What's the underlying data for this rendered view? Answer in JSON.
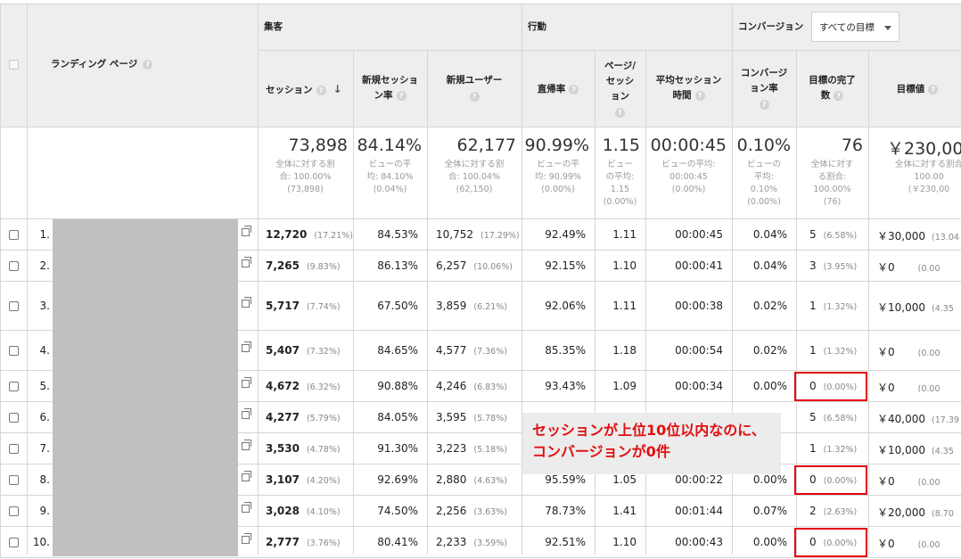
{
  "column_groups": {
    "acquisition": "集客",
    "behavior": "行動",
    "conversions": "コンバージョン"
  },
  "goal_selector": {
    "value": "すべての目標"
  },
  "columns": {
    "landing_page": "ランディング ページ",
    "sessions": "セッション",
    "new_session_rate": [
      "新規セッショ",
      "ン率"
    ],
    "new_users": "新規ユーザー",
    "bounce_rate": "直帰率",
    "pages_per_session": [
      "ページ/",
      "セッシ",
      "ョン"
    ],
    "avg_session_duration": [
      "平均セッション",
      "時間"
    ],
    "conversion_rate": [
      "コンバージ",
      "ョン率"
    ],
    "goal_completions": [
      "目標の完了",
      "数"
    ],
    "goal_value": "目標値"
  },
  "totals": {
    "sessions": {
      "value": "73,898",
      "lines": [
        "全体に対する割",
        "合: 100.00%",
        "(73,898)"
      ]
    },
    "new_session_rate": {
      "value": "84.14%",
      "lines": [
        "ビューの平",
        "均: 84.10%",
        "(0.04%)"
      ]
    },
    "new_users": {
      "value": "62,177",
      "lines": [
        "全体に対する割",
        "合: 100.04%",
        "(62,150)"
      ]
    },
    "bounce_rate": {
      "value": "90.99%",
      "lines": [
        "ビューの平",
        "均: 90.99%",
        "(0.00%)"
      ]
    },
    "pages_per_session": {
      "value": "1.15",
      "lines": [
        "ビュー",
        "の平均:",
        "1.15",
        "(0.00%)"
      ]
    },
    "avg_session_duration": {
      "value": "00:00:45",
      "lines": [
        "ビューの平均:",
        "00:00:45",
        "(0.00%)"
      ]
    },
    "conversion_rate": {
      "value": "0.10%",
      "lines": [
        "ビューの",
        "平均:",
        "0.10%",
        "(0.00%)"
      ]
    },
    "goal_completions": {
      "value": "76",
      "lines": [
        "全体に対す",
        "る割合:",
        "100.00%",
        "(76)"
      ]
    },
    "goal_value": {
      "value": "￥230,00",
      "lines": [
        "全体に対する割合",
        "100.00",
        "(￥230,00"
      ]
    }
  },
  "rows": [
    {
      "num": "1.",
      "sessions": "12,720",
      "sessions_pct": "(17.21%)",
      "new_session_rate": "84.53%",
      "new_users": "10,752",
      "new_users_pct": "(17.29%)",
      "bounce_rate": "92.49%",
      "pages_per_session": "1.11",
      "avg_session_duration": "00:00:45",
      "conversion_rate": "0.04%",
      "goal_completions": "5",
      "goal_completions_pct": "(6.58%)",
      "goal_value": "￥30,000",
      "goal_value_pct": "(13.04"
    },
    {
      "num": "2.",
      "sessions": "7,265",
      "sessions_pct": "(9.83%)",
      "new_session_rate": "86.13%",
      "new_users": "6,257",
      "new_users_pct": "(10.06%)",
      "bounce_rate": "92.15%",
      "pages_per_session": "1.10",
      "avg_session_duration": "00:00:41",
      "conversion_rate": "0.04%",
      "goal_completions": "3",
      "goal_completions_pct": "(3.95%)",
      "goal_value": "￥0",
      "goal_value_pct": "(0.00"
    },
    {
      "num": "3.",
      "sessions": "5,717",
      "sessions_pct": "(7.74%)",
      "new_session_rate": "67.50%",
      "new_users": "3,859",
      "new_users_pct": "(6.21%)",
      "bounce_rate": "92.06%",
      "pages_per_session": "1.11",
      "avg_session_duration": "00:00:38",
      "conversion_rate": "0.02%",
      "goal_completions": "1",
      "goal_completions_pct": "(1.32%)",
      "goal_value": "￥10,000",
      "goal_value_pct": "(4.35"
    },
    {
      "num": "4.",
      "sessions": "5,407",
      "sessions_pct": "(7.32%)",
      "new_session_rate": "84.65%",
      "new_users": "4,577",
      "new_users_pct": "(7.36%)",
      "bounce_rate": "85.35%",
      "pages_per_session": "1.18",
      "avg_session_duration": "00:00:54",
      "conversion_rate": "0.02%",
      "goal_completions": "1",
      "goal_completions_pct": "(1.32%)",
      "goal_value": "￥0",
      "goal_value_pct": "(0.00"
    },
    {
      "num": "5.",
      "sessions": "4,672",
      "sessions_pct": "(6.32%)",
      "new_session_rate": "90.88%",
      "new_users": "4,246",
      "new_users_pct": "(6.83%)",
      "bounce_rate": "93.43%",
      "pages_per_session": "1.09",
      "avg_session_duration": "00:00:34",
      "conversion_rate": "0.00%",
      "goal_completions": "0",
      "goal_completions_pct": "(0.00%)",
      "goal_value": "￥0",
      "goal_value_pct": "(0.00"
    },
    {
      "num": "6.",
      "sessions": "4,277",
      "sessions_pct": "(5.79%)",
      "new_session_rate": "84.05%",
      "new_users": "3,595",
      "new_users_pct": "(5.78%)",
      "bounce_rate": "",
      "pages_per_session": "",
      "avg_session_duration": "",
      "conversion_rate": "",
      "goal_completions": "5",
      "goal_completions_pct": "(6.58%)",
      "goal_value": "￥40,000",
      "goal_value_pct": "(17.39"
    },
    {
      "num": "7.",
      "sessions": "3,530",
      "sessions_pct": "(4.78%)",
      "new_session_rate": "91.30%",
      "new_users": "3,223",
      "new_users_pct": "(5.18%)",
      "bounce_rate": "",
      "pages_per_session": "",
      "avg_session_duration": "",
      "conversion_rate": "",
      "goal_completions": "1",
      "goal_completions_pct": "(1.32%)",
      "goal_value": "￥10,000",
      "goal_value_pct": "(4.35"
    },
    {
      "num": "8.",
      "sessions": "3,107",
      "sessions_pct": "(4.20%)",
      "new_session_rate": "92.69%",
      "new_users": "2,880",
      "new_users_pct": "(4.63%)",
      "bounce_rate": "95.59%",
      "pages_per_session": "1.05",
      "avg_session_duration": "00:00:22",
      "conversion_rate": "0.00%",
      "goal_completions": "0",
      "goal_completions_pct": "(0.00%)",
      "goal_value": "￥0",
      "goal_value_pct": "(0.00"
    },
    {
      "num": "9.",
      "sessions": "3,028",
      "sessions_pct": "(4.10%)",
      "new_session_rate": "74.50%",
      "new_users": "2,256",
      "new_users_pct": "(3.63%)",
      "bounce_rate": "78.73%",
      "pages_per_session": "1.41",
      "avg_session_duration": "00:01:44",
      "conversion_rate": "0.07%",
      "goal_completions": "2",
      "goal_completions_pct": "(2.63%)",
      "goal_value": "￥20,000",
      "goal_value_pct": "(8.70"
    },
    {
      "num": "10.",
      "sessions": "2,777",
      "sessions_pct": "(3.76%)",
      "new_session_rate": "80.41%",
      "new_users": "2,233",
      "new_users_pct": "(3.59%)",
      "bounce_rate": "92.51%",
      "pages_per_session": "1.10",
      "avg_session_duration": "00:00:43",
      "conversion_rate": "0.00%",
      "goal_completions": "0",
      "goal_completions_pct": "(0.00%)",
      "goal_value": "￥0",
      "goal_value_pct": "(0.00"
    }
  ],
  "annotation": {
    "lines": [
      "セッションが上位10位以内なのに、",
      "コンバージョンが0件"
    ],
    "color": "#e20f0f",
    "highlighted_rows": [
      "5.",
      "8.",
      "10."
    ]
  },
  "icons": {
    "help": "help-circle-icon",
    "sort": "sort-descending-icon",
    "external_link": "open-in-new-icon",
    "dropdown": "caret-down-icon"
  },
  "colors": {
    "header_bg": "#eeeeee",
    "grid": "#d6d6d6",
    "highlight_border": "#e8000d"
  }
}
